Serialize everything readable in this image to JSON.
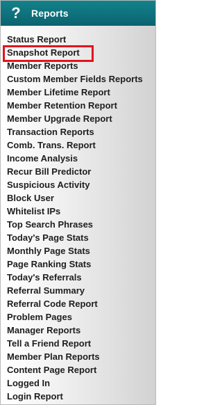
{
  "header": {
    "icon": "question-mark-icon",
    "icon_glyph": "?",
    "title": "Reports",
    "color_top": "#13828b",
    "color_bottom": "#0b6470"
  },
  "menu": {
    "items": [
      "Status Report",
      "Snapshot Report",
      "Member Reports",
      "Custom Member Fields Reports",
      "Member Lifetime Report",
      "Member Retention Report",
      "Member Upgrade Report",
      "Transaction Reports",
      "Comb. Trans. Report",
      "Income Analysis",
      "Recur Bill Predictor",
      "Suspicious Activity",
      "Block User",
      "Whitelist IPs",
      "Top Search Phrases",
      "Today's Page Stats",
      "Monthly Page Stats",
      "Page Ranking Stats",
      "Today's Referrals",
      "Referral Summary",
      "Referral Code Report",
      "Problem Pages",
      "Manager Reports",
      "Tell a Friend Report",
      "Member Plan Reports",
      "Content Page Report",
      "Logged In",
      "Login Report"
    ],
    "highlighted_item": "Snapshot Report",
    "highlight_color": "#e3141b"
  }
}
